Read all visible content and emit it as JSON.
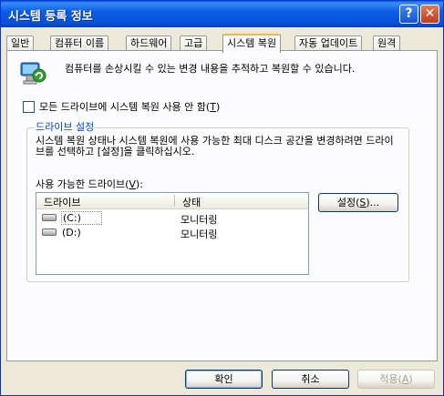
{
  "window": {
    "title": "시스템 등록 정보",
    "help_symbol": "?",
    "close_symbol": "✕"
  },
  "tabs": [
    {
      "label": "일반"
    },
    {
      "label": "컴퓨터 이름"
    },
    {
      "label": "하드웨어"
    },
    {
      "label": "고급"
    },
    {
      "label": "시스템 복원",
      "active": true
    },
    {
      "label": "자동 업데이트"
    },
    {
      "label": "원격"
    }
  ],
  "intro_text": "컴퓨터를 손상시킬 수 있는 변경 내용을 추적하고 복원할 수 있습니다.",
  "disable_checkbox": {
    "label_before": "모든 드라이브에 시스템 복원 사용 안 함(",
    "accel": "T",
    "label_after": ")",
    "checked": false
  },
  "drive_settings": {
    "group_label": "드라이브 설정",
    "description": "시스템 복원 상태나 시스템 복원에 사용 가능한 최대 디스크 공간을 변경하려면 드라이브를 선택하고 [설정]을 클릭하십시오.",
    "available_label_before": "사용 가능한 드라이브(",
    "available_accel": "V",
    "available_label_after": "):",
    "columns": {
      "drive": "드라이브",
      "status": "상태"
    },
    "drives": [
      {
        "name": "(C:)",
        "status": "모니터링",
        "icon": "hard-drive-icon"
      },
      {
        "name": "(D:)",
        "status": "모니터링",
        "icon": "hard-drive-icon"
      }
    ],
    "settings_button": {
      "before": "설정(",
      "accel": "S",
      "after": ")..."
    }
  },
  "footer": {
    "ok": "확인",
    "cancel": "취소",
    "apply_before": "적용(",
    "apply_accel": "A",
    "apply_after": ")"
  },
  "colors": {
    "titlebar": "#0b5ee3",
    "tab_highlight": "#f9b33e",
    "group_label": "#0046d5"
  }
}
